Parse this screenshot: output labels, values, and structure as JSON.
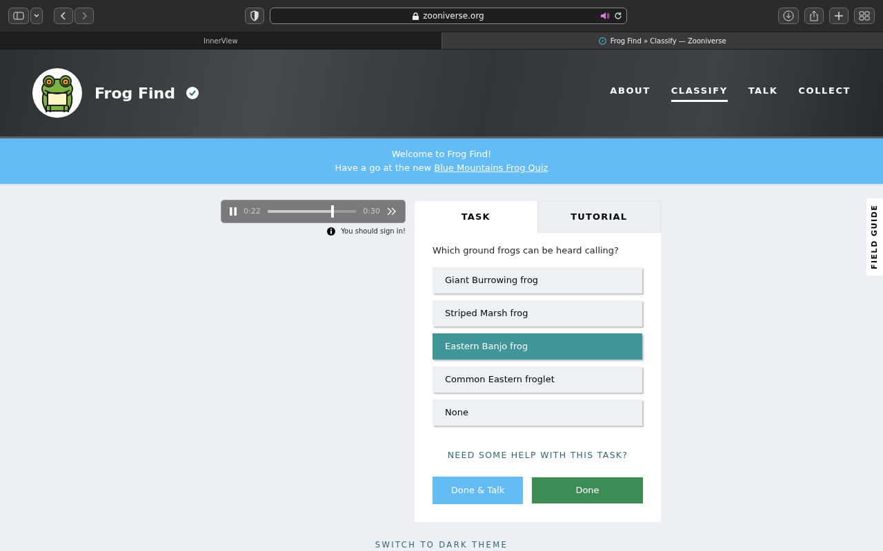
{
  "browser": {
    "url": "zooniverse.org",
    "audio_playing": true,
    "tabs": [
      {
        "title": "InnerView",
        "selected": false
      },
      {
        "title": "Frog Find » Classify — Zooniverse",
        "selected": true
      }
    ]
  },
  "header": {
    "title": "Frog Find",
    "verified": true,
    "nav": [
      {
        "label": "ABOUT",
        "selected": false
      },
      {
        "label": "CLASSIFY",
        "selected": true
      },
      {
        "label": "TALK",
        "selected": false
      },
      {
        "label": "COLLECT",
        "selected": false
      }
    ]
  },
  "banner": {
    "line_1": "Welcome to Frog Find!",
    "line_2_text": "Have a go at the new ",
    "line_2_link": "Blue Mountains Frog Quiz"
  },
  "player": {
    "playing": true,
    "current_time": "0:22",
    "duration": "0:30",
    "level": 0.73
  },
  "notice": "You should sign in!",
  "task_tabs": [
    {
      "label": "TASK",
      "selected": true
    },
    {
      "label": "TUTORIAL",
      "selected": false
    }
  ],
  "question": "Which ground frogs can be heard calling?",
  "answers": [
    {
      "label": "Giant Burrowing frog",
      "selected": false
    },
    {
      "label": "Striped Marsh frog",
      "selected": false
    },
    {
      "label": "Eastern Banjo frog",
      "selected": true
    },
    {
      "label": "Common Eastern froglet",
      "selected": false
    },
    {
      "label": "None",
      "selected": false
    }
  ],
  "help_link": "NEED SOME HELP WITH THIS TASK?",
  "buttons": [
    {
      "label": "Done & Talk",
      "kind": "talk"
    },
    {
      "label": "Done",
      "kind": "done"
    }
  ],
  "field_guide": "FIELD GUIDE",
  "theme_switch": "SWITCH TO DARK THEME"
}
